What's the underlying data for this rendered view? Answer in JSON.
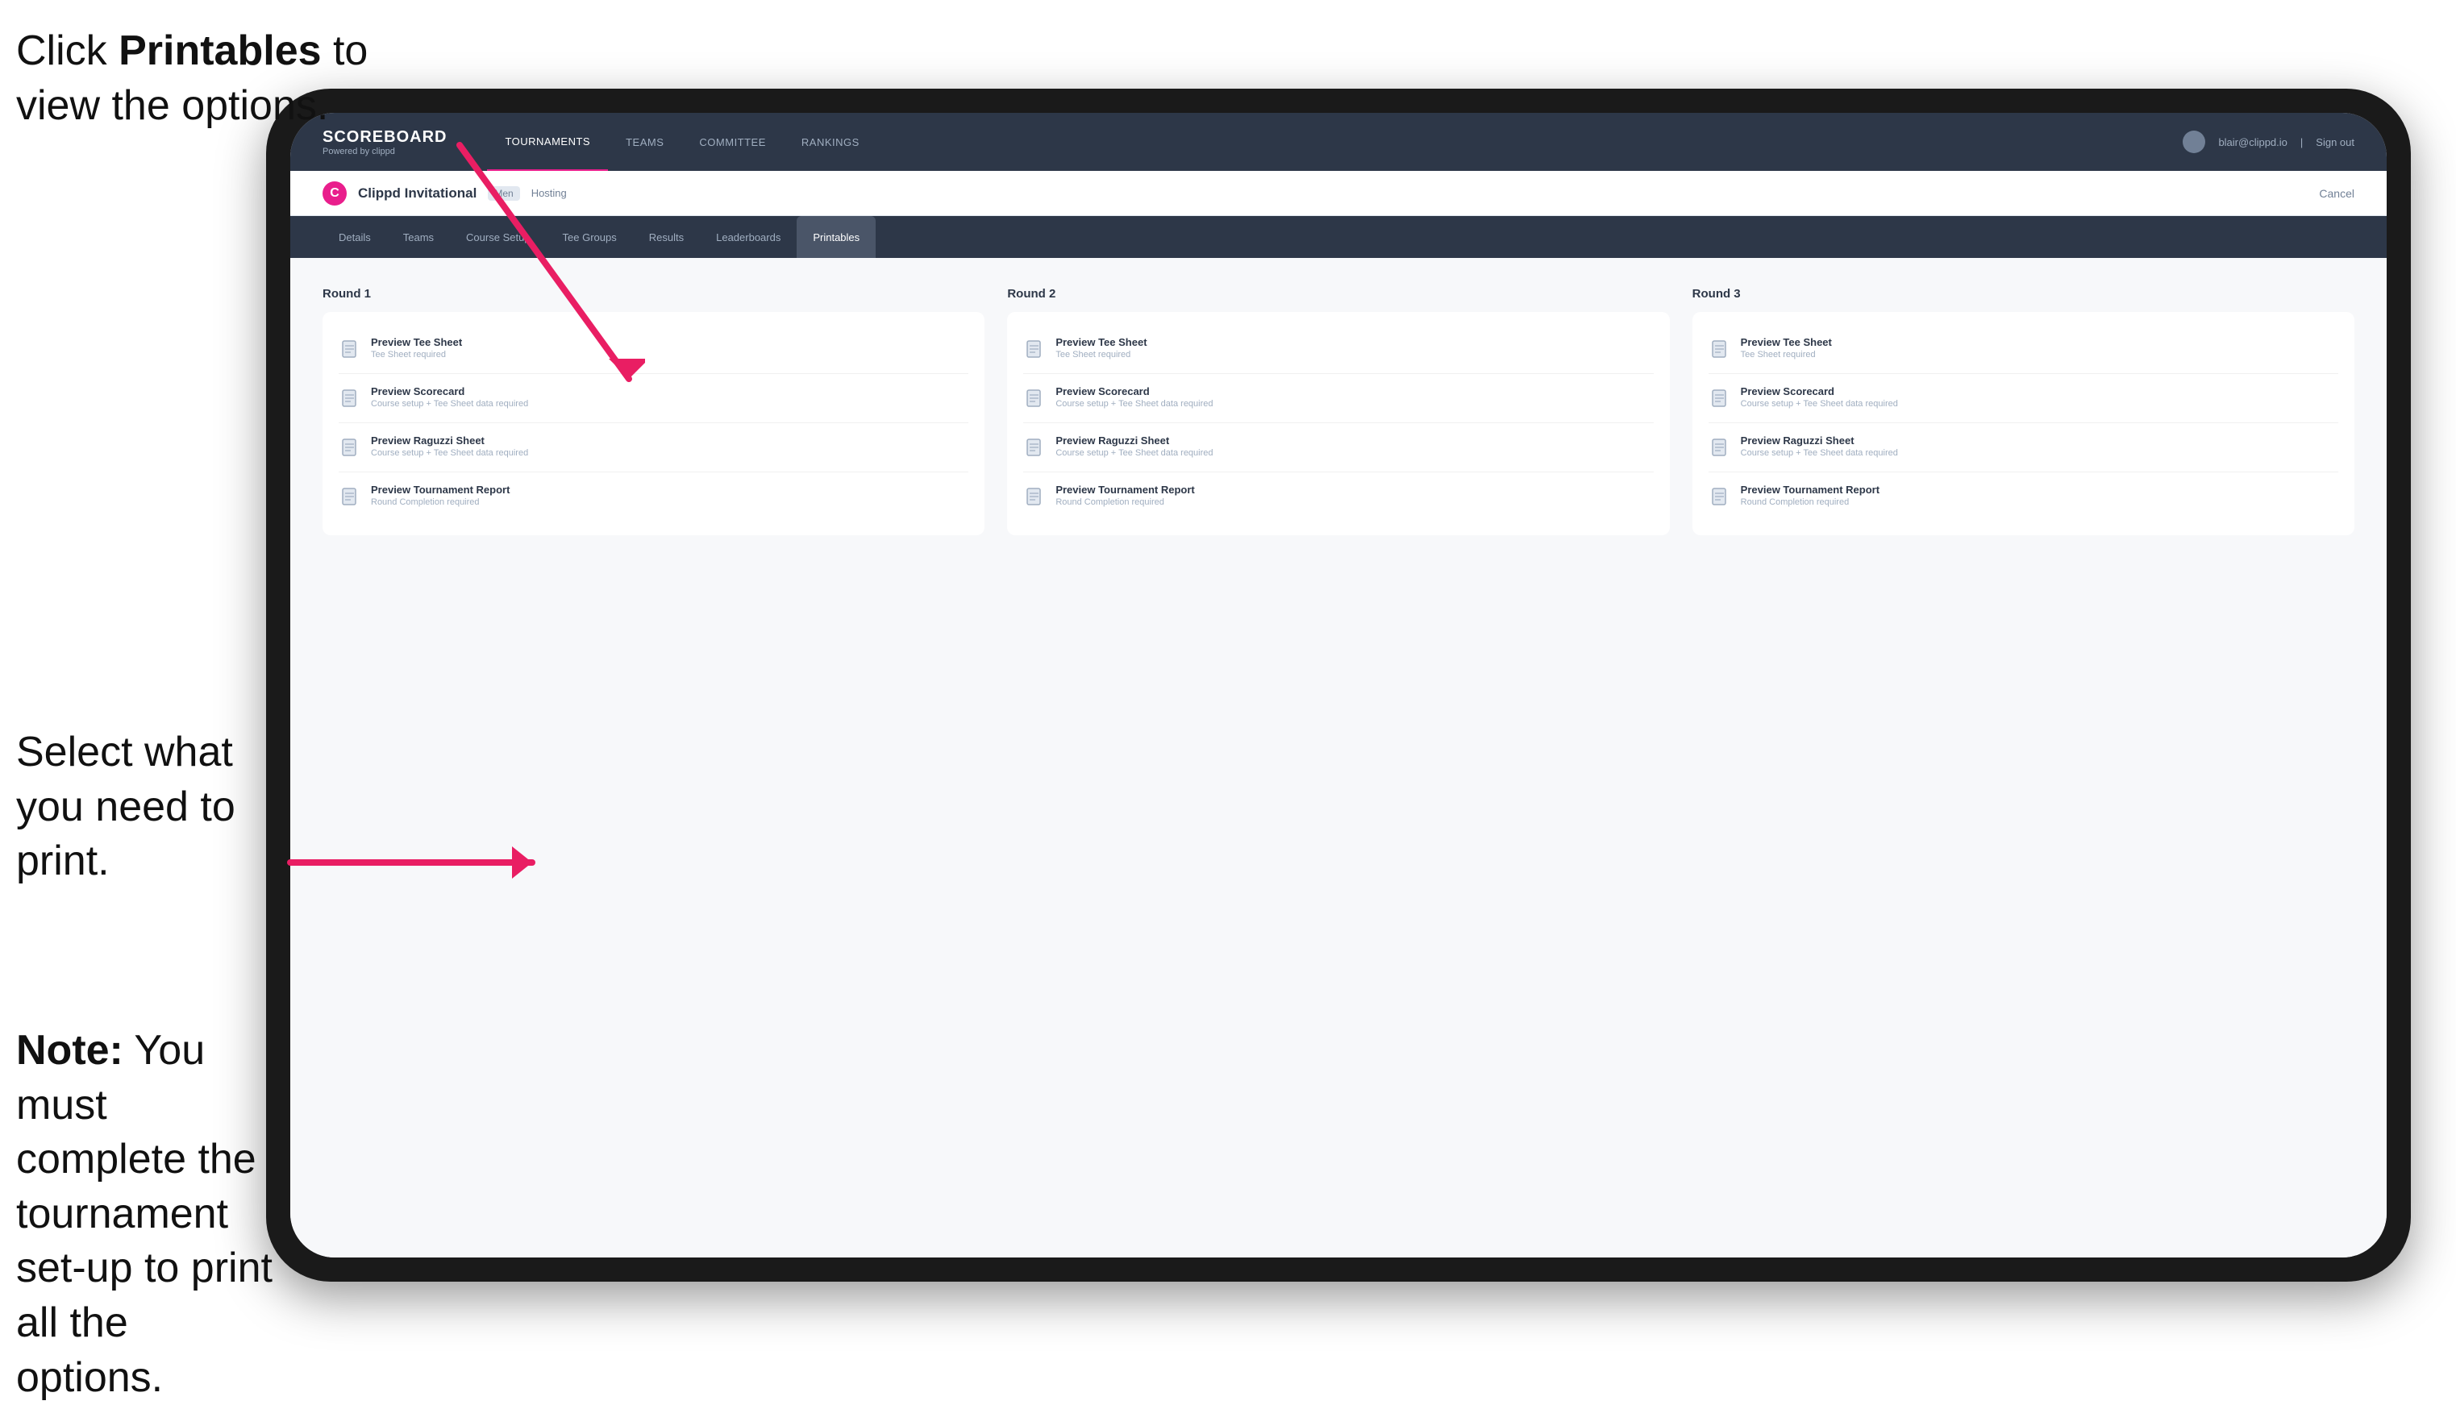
{
  "instructions": {
    "top_line1": "Click ",
    "top_bold": "Printables",
    "top_line2": " to",
    "top_line3": "view the options.",
    "middle": "Select what you need to print.",
    "bottom_bold": "Note:",
    "bottom_text": " You must complete the tournament set-up to print all the options."
  },
  "nav": {
    "logo": "SCOREBOARD",
    "logo_sub": "Powered by clippd",
    "links": [
      "TOURNAMENTS",
      "TEAMS",
      "COMMITTEE",
      "RANKINGS"
    ],
    "active_link": "TOURNAMENTS",
    "user_email": "blair@clippd.io",
    "sign_out": "Sign out"
  },
  "tournament": {
    "name": "Clippd Invitational",
    "badge": "Men",
    "hosting": "Hosting",
    "cancel": "Cancel"
  },
  "tabs": [
    "Details",
    "Teams",
    "Course Setup",
    "Tee Groups",
    "Results",
    "Leaderboards",
    "Printables"
  ],
  "active_tab": "Printables",
  "rounds": [
    {
      "title": "Round 1",
      "items": [
        {
          "label": "Preview Tee Sheet",
          "sublabel": "Tee Sheet required"
        },
        {
          "label": "Preview Scorecard",
          "sublabel": "Course setup + Tee Sheet data required"
        },
        {
          "label": "Preview Raguzzi Sheet",
          "sublabel": "Course setup + Tee Sheet data required"
        },
        {
          "label": "Preview Tournament Report",
          "sublabel": "Round Completion required"
        }
      ]
    },
    {
      "title": "Round 2",
      "items": [
        {
          "label": "Preview Tee Sheet",
          "sublabel": "Tee Sheet required"
        },
        {
          "label": "Preview Scorecard",
          "sublabel": "Course setup + Tee Sheet data required"
        },
        {
          "label": "Preview Raguzzi Sheet",
          "sublabel": "Course setup + Tee Sheet data required"
        },
        {
          "label": "Preview Tournament Report",
          "sublabel": "Round Completion required"
        }
      ]
    },
    {
      "title": "Round 3",
      "items": [
        {
          "label": "Preview Tee Sheet",
          "sublabel": "Tee Sheet required"
        },
        {
          "label": "Preview Scorecard",
          "sublabel": "Course setup + Tee Sheet data required"
        },
        {
          "label": "Preview Raguzzi Sheet",
          "sublabel": "Course setup + Tee Sheet data required"
        },
        {
          "label": "Preview Tournament Report",
          "sublabel": "Round Completion required"
        }
      ]
    }
  ]
}
